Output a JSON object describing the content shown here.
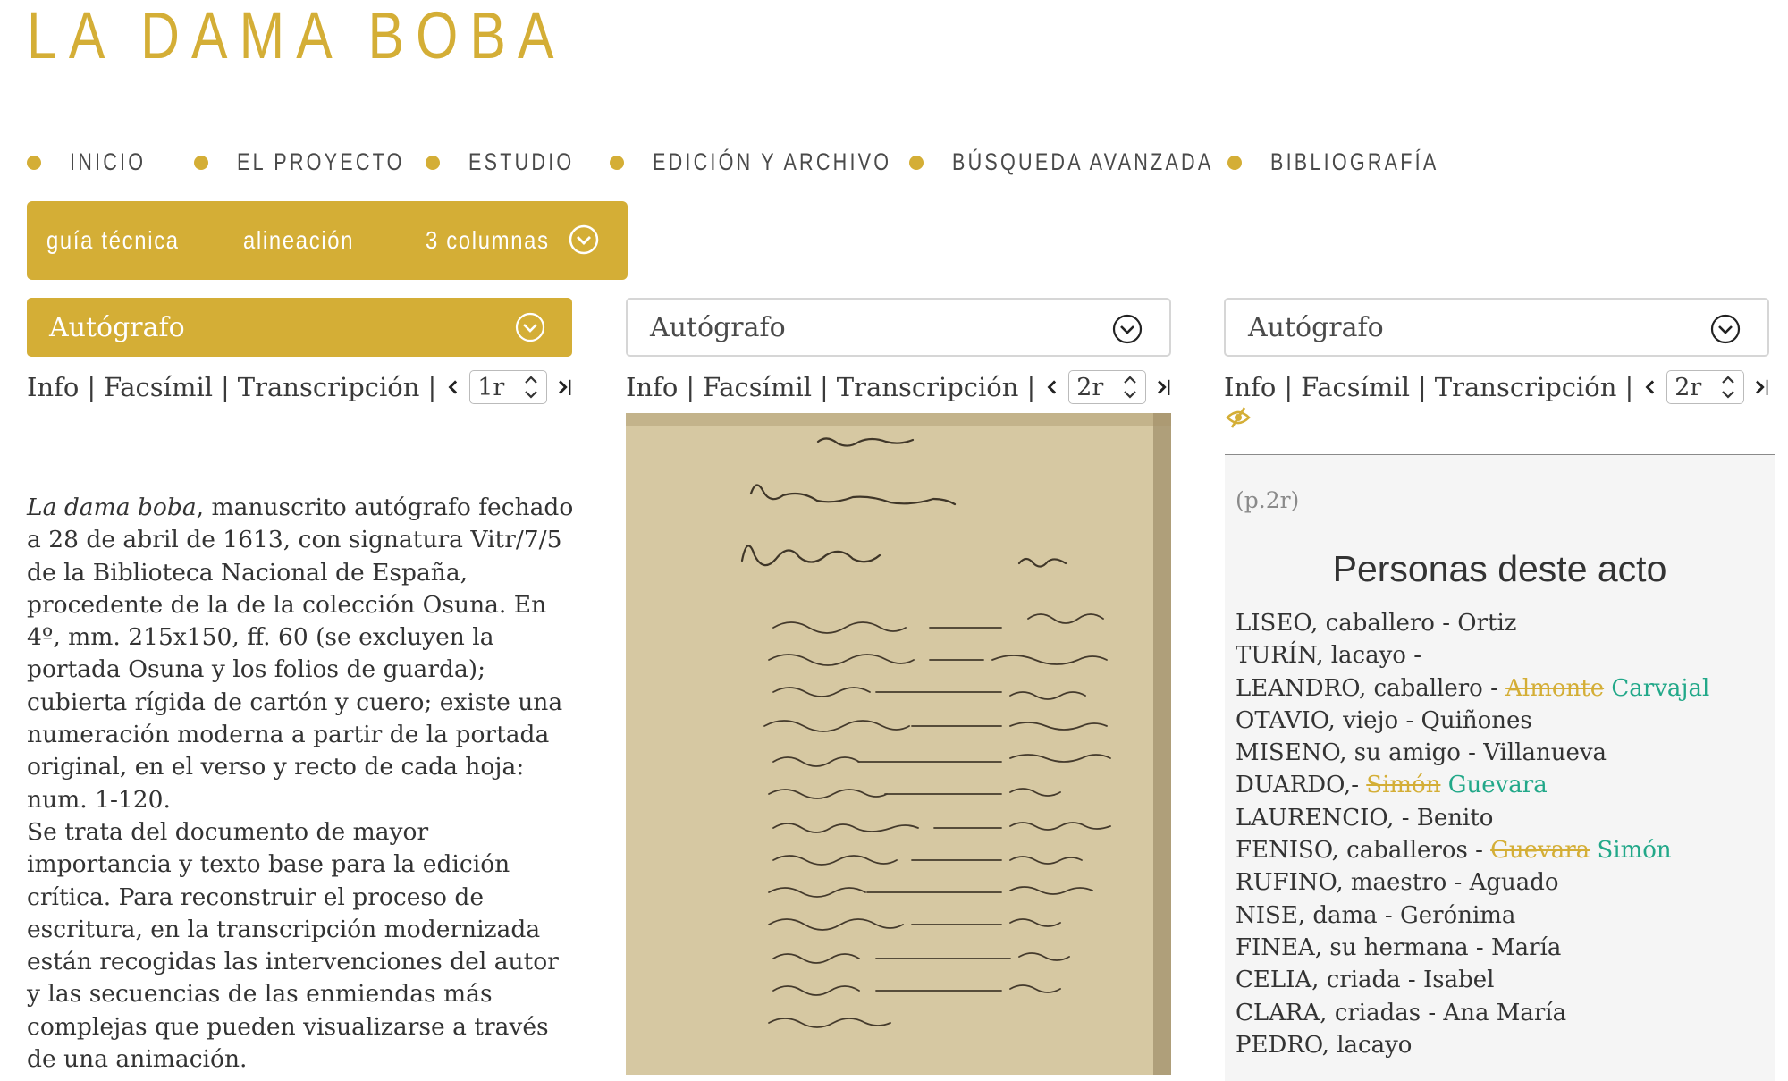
{
  "site": {
    "title": "LA DAMA BOBA"
  },
  "nav": {
    "items": [
      {
        "label": "INICIO"
      },
      {
        "label": "EL PROYECTO"
      },
      {
        "label": "ESTUDIO"
      },
      {
        "label": "EDICIÓN Y ARCHIVO"
      },
      {
        "label": "BÚSQUEDA AVANZADA"
      },
      {
        "label": "BIBLIOGRAFÍA"
      }
    ]
  },
  "toolbar": {
    "guide": "guía técnica",
    "align": "alineación",
    "columns": "3 columnas",
    "toggle_icon": "chevron-down-circle-icon"
  },
  "columns": [
    {
      "selected": "Autógrafo",
      "links": {
        "info": "Info",
        "facsimile": "Facsímil",
        "transcription": "Transcripción"
      },
      "page": "1r"
    },
    {
      "selected": "Autógrafo",
      "links": {
        "info": "Info",
        "facsimile": "Facsímil",
        "transcription": "Transcripción"
      },
      "page": "2r"
    },
    {
      "selected": "Autógrafo",
      "links": {
        "info": "Info",
        "facsimile": "Facsímil",
        "transcription": "Transcripción"
      },
      "page": "2r"
    }
  ],
  "separator": "|",
  "description": {
    "title_italic": "La dama boba",
    "p1_rest": ", manuscrito autógrafo fechado a 28 de abril de 1613, con signatura Vitr/7/5 de la Biblioteca Nacional de España, procedente de la de la colección Osuna. En 4º, mm. 215x150, ff. 60 (se excluyen la portada Osuna y los folios de guarda); cubierta rígida de cartón y cuero; existe una numeración moderna a partir de la portada original, en el verso y recto de cada hoja: num. 1-120.",
    "p2": "Se trata del documento de mayor importancia y texto base para la edición crítica. Para reconstruir el proceso de escritura, en la transcripción modernizada están recogidas las intervenciones del autor y las secuencias de las enmiendas más complejas que pueden visualizarse a través de una animación."
  },
  "transcription": {
    "page_ref": "(p.2r)",
    "title": "Personas deste acto",
    "characters": [
      {
        "text": "LISEO, caballero - Ortiz"
      },
      {
        "text": "TURÍN, lacayo -"
      },
      {
        "text": "LEANDRO, caballero - ",
        "struck": "Almonte",
        "added": "Carvajal"
      },
      {
        "text": "OTAVIO, viejo - Quiñones"
      },
      {
        "text": "MISENO, su amigo - Villanueva"
      },
      {
        "text": "DUARDO,- ",
        "struck": "Simón",
        "added": "Guevara"
      },
      {
        "text": "LAURENCIO, - Benito"
      },
      {
        "text": "FENISO, caballeros - ",
        "struck": "Guevara",
        "added": "Simón"
      },
      {
        "text": "RUFINO, maestro - Aguado"
      },
      {
        "text": "NISE, dama - Gerónima"
      },
      {
        "text": "FINEA, su hermana - María"
      },
      {
        "text": "CELIA, criada - Isabel"
      },
      {
        "text": "CLARA, criadas - Ana María"
      },
      {
        "text": "PEDRO, lacayo"
      }
    ]
  },
  "colors": {
    "accent": "#d4ae36",
    "added": "#22a889",
    "panel": "#f5f5f5"
  }
}
